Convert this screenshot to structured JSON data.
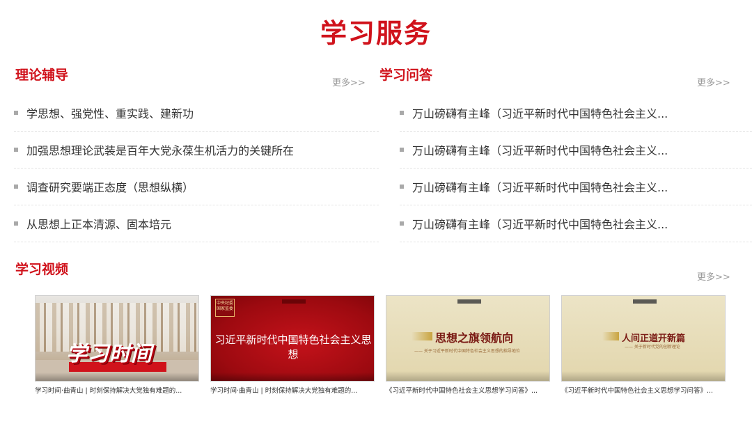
{
  "page": {
    "title": "学习服务"
  },
  "theory": {
    "title": "理论辅导",
    "more": "更多>>",
    "items": [
      "学思想、强党性、重实践、建新功",
      "加强思想理论武装是百年大党永葆生机活力的关键所在",
      "调查研究要端正态度（思想纵横）",
      "从思想上正本清源、固本培元"
    ]
  },
  "qa": {
    "title": "学习问答",
    "more": "更多>>",
    "items": [
      "万山磅礴有主峰（习近平新时代中国特色社会主义...",
      "万山磅礴有主峰（习近平新时代中国特色社会主义...",
      "万山磅礴有主峰（习近平新时代中国特色社会主义...",
      "万山磅礴有主峰（习近平新时代中国特色社会主义..."
    ]
  },
  "video": {
    "title": "学习视频",
    "more": "更多>>",
    "cards": [
      {
        "caption": "学习时间·曲青山 | 时刻保持解决大党独有难题的...",
        "thumb_text": "学习时间"
      },
      {
        "caption": "学习时间·曲青山 | 时刻保持解决大党独有难题的...",
        "thumb_text": "习近平新时代中国特色社会主义思想",
        "badge": "中央纪委国家监委"
      },
      {
        "caption": "《习近平新时代中国特色社会主义思想学习问答》...",
        "thumb_text": "思想之旗领航向",
        "thumb_sub": "—— 关于习近平新时代中国特色社会主义思想的指导地位"
      },
      {
        "caption": "《习近平新时代中国特色社会主义思想学习问答》...",
        "thumb_text": "人间正道开新篇",
        "thumb_sub": "—— 关于新时代党的创新理论"
      }
    ]
  },
  "colors": {
    "accent": "#d0121b",
    "muted": "#999999",
    "text": "#333333"
  }
}
